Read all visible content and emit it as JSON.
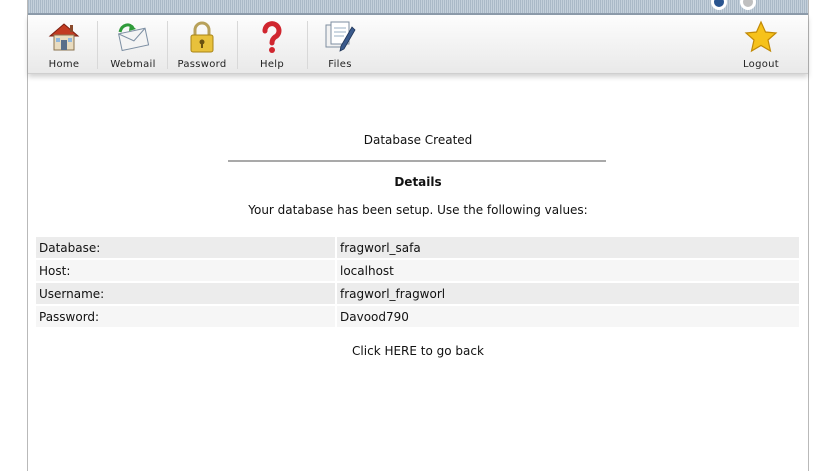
{
  "toolbar": {
    "items": [
      {
        "label": "Home",
        "icon": "home-icon"
      },
      {
        "label": "Webmail",
        "icon": "webmail-icon"
      },
      {
        "label": "Password",
        "icon": "padlock-icon"
      },
      {
        "label": "Help",
        "icon": "question-mark-icon"
      },
      {
        "label": "Files",
        "icon": "files-icon"
      }
    ],
    "logout_label": "Logout",
    "logout_icon": "star-icon"
  },
  "page": {
    "title": "Database Created",
    "details_heading": "Details",
    "intro": "Your database has been setup. Use the following values:",
    "rows": [
      {
        "key": "Database:",
        "value": "fragworl_safa"
      },
      {
        "key": "Host:",
        "value": "localhost"
      },
      {
        "key": "Username:",
        "value": "fragworl_fragworl"
      },
      {
        "key": "Password:",
        "value": "Davood790"
      }
    ],
    "back_link": "Click HERE to go back"
  },
  "colors": {
    "row_odd": "#ececec",
    "row_even": "#f6f6f6",
    "rule": "#a9a9a9"
  }
}
